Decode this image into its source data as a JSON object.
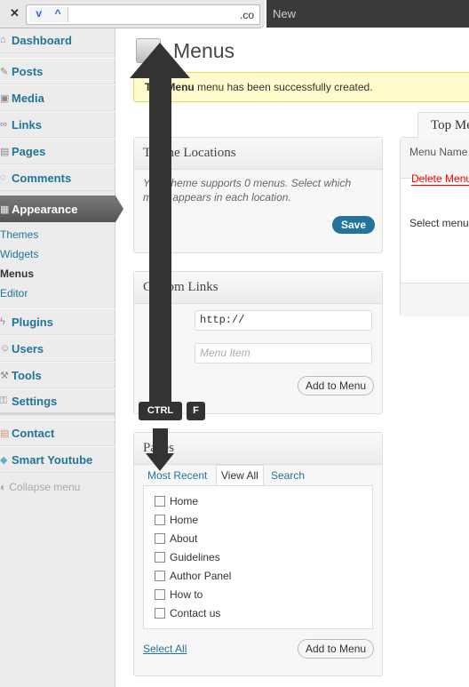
{
  "findbar": {
    "value": ".co",
    "down": "⌄",
    "up": "⌃",
    "close": "✕"
  },
  "tabbar": {
    "new_tab": "New"
  },
  "sidebar": {
    "items": [
      {
        "label": "Dashboard",
        "icon": "dashboard-icon"
      },
      {
        "label": "Posts",
        "icon": "pin-icon"
      },
      {
        "label": "Media",
        "icon": "media-icon"
      },
      {
        "label": "Links",
        "icon": "link-icon"
      },
      {
        "label": "Pages",
        "icon": "page-icon"
      },
      {
        "label": "Comments",
        "icon": "comment-icon"
      },
      {
        "label": "Appearance",
        "icon": "appearance-icon"
      },
      {
        "label": "Plugins",
        "icon": "plugin-icon"
      },
      {
        "label": "Users",
        "icon": "user-icon"
      },
      {
        "label": "Tools",
        "icon": "tools-icon"
      },
      {
        "label": "Settings",
        "icon": "settings-icon"
      },
      {
        "label": "Contact",
        "icon": "contact-icon"
      },
      {
        "label": "Smart Youtube",
        "icon": "youtube-icon"
      }
    ],
    "submenu": [
      "Themes",
      "Widgets",
      "Menus",
      "Editor"
    ],
    "collapse": "Collapse menu"
  },
  "page": {
    "title": "Menus",
    "notice": {
      "bold": "Top Menu",
      "text": " menu has been successfully created."
    }
  },
  "theme_locations": {
    "title": "Theme Locations",
    "text": "Your theme supports 0 menus. Select which menu appears in each location.",
    "save": "Save"
  },
  "custom_links": {
    "title": "Custom Links",
    "url_value": "http://",
    "label_placeholder": "Menu Item",
    "add": "Add to Menu"
  },
  "pages_box": {
    "title": "Pages",
    "tabs": [
      "Most Recent",
      "View All",
      "Search"
    ],
    "items": [
      "Home",
      "Home",
      "About",
      "Guidelines",
      "Author Panel",
      "How to",
      "Contact us"
    ],
    "select_all": "Select All",
    "add": "Add to Menu"
  },
  "menu_editor": {
    "tab": "Top Menu",
    "menu_name_label": "Menu Name",
    "delete": "Delete Menu",
    "select_text": "Select menu"
  },
  "overlay": {
    "keys": [
      "CTRL",
      "F"
    ]
  },
  "colors": {
    "link": "#21759b",
    "primary_button": "#21759b",
    "notice_bg": "#fffbcc",
    "delete": "#ff0000",
    "arrow": "#333333"
  }
}
